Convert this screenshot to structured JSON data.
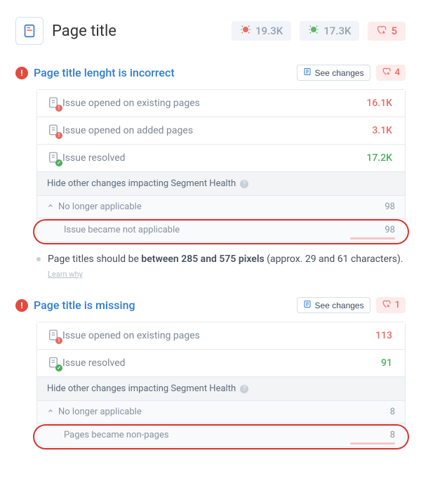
{
  "header": {
    "title": "Page title",
    "stat_bug_red": "19.3K",
    "stat_bug_green": "17.3K",
    "stat_heart": "5"
  },
  "issues": [
    {
      "title": "Page title lenght is incorrect",
      "see_changes_label": "See changes",
      "heart_count": "4",
      "rows": [
        {
          "label": "Issue opened on existing pages",
          "value": "16.1K",
          "style": "red",
          "badge": "red"
        },
        {
          "label": "Issue opened on added pages",
          "value": "3.1K",
          "style": "red",
          "badge": "red"
        },
        {
          "label": "Issue resolved",
          "value": "17.2K",
          "style": "green",
          "badge": "green"
        }
      ],
      "section_header": "Hide other changes impacting Segment Health",
      "subhead": {
        "label": "No longer applicable",
        "value": "98"
      },
      "subrow": {
        "label": "Issue became not applicable",
        "value": "98"
      }
    },
    {
      "title": "Page title is missing",
      "see_changes_label": "See changes",
      "heart_count": "1",
      "rows": [
        {
          "label": "Issue opened on existing pages",
          "value": "113",
          "style": "red",
          "badge": "red"
        },
        {
          "label": "Issue resolved",
          "value": "91",
          "style": "green",
          "badge": "green"
        }
      ],
      "section_header": "Hide other changes impacting Segment Health",
      "subhead": {
        "label": "No longer applicable",
        "value": "8"
      },
      "subrow": {
        "label": "Pages became non-pages",
        "value": "8"
      }
    }
  ],
  "description": {
    "prefix": "Page titles should be ",
    "bold": "between 285 and 575 pixels",
    "suffix": " (approx. 29 and 61 characters). ",
    "learn": "Learn why"
  }
}
